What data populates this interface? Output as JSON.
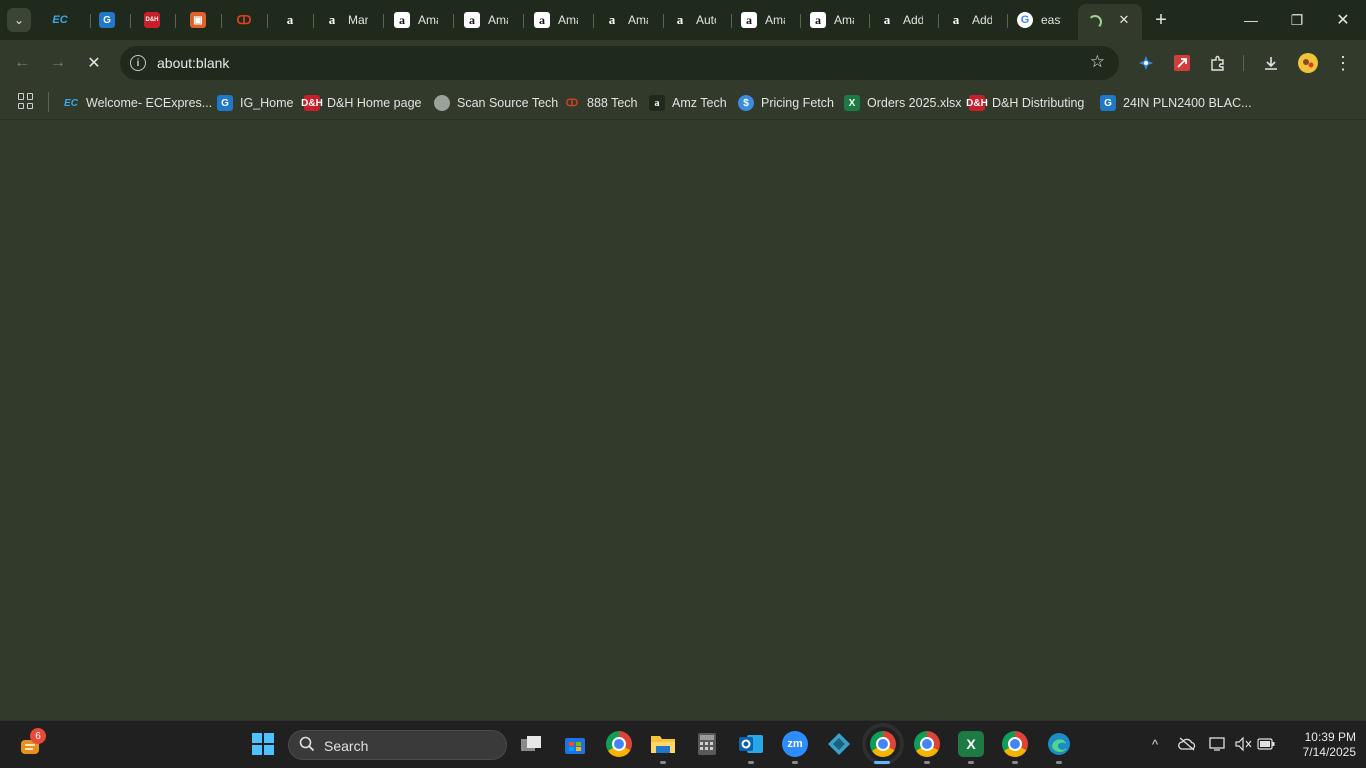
{
  "tabs": [
    {
      "title": "",
      "icon": "ec-icon"
    },
    {
      "title": "",
      "icon": "ig-icon"
    },
    {
      "title": "",
      "icon": "dh-icon"
    },
    {
      "title": "",
      "icon": "box-icon"
    },
    {
      "title": "",
      "icon": "ring-icon"
    },
    {
      "title": "",
      "icon": "amazon-icon"
    },
    {
      "title": "Man",
      "icon": "amazon-icon"
    },
    {
      "title": "Ama",
      "icon": "amazon-icon"
    },
    {
      "title": "Ama",
      "icon": "amazon-icon"
    },
    {
      "title": "Ama",
      "icon": "amazon-icon"
    },
    {
      "title": "Ama",
      "icon": "amazon-icon"
    },
    {
      "title": "Auto",
      "icon": "amazon-icon"
    },
    {
      "title": "Ama",
      "icon": "amazon-icon"
    },
    {
      "title": "Ama",
      "icon": "amazon-icon"
    },
    {
      "title": "Add",
      "icon": "amazon-icon"
    },
    {
      "title": "Add",
      "icon": "amazon-icon"
    },
    {
      "title": "east",
      "icon": "google-icon"
    },
    {
      "title": "",
      "icon": "loading-spinner",
      "active": true
    }
  ],
  "omnibox": {
    "url": "about:blank"
  },
  "bookmarks": [
    {
      "label": "Welcome- ECExpres...",
      "icon": "ec-icon"
    },
    {
      "label": "IG_Home",
      "icon": "ig-icon"
    },
    {
      "label": "D&H Home page",
      "icon": "dh-icon"
    },
    {
      "label": "Scan Source Tech",
      "icon": "globe-icon"
    },
    {
      "label": "888 Tech",
      "icon": "ring-icon"
    },
    {
      "label": "Amz Tech",
      "icon": "amazon-icon"
    },
    {
      "label": "Pricing Fetch",
      "icon": "dollar-icon"
    },
    {
      "label": "Orders 2025.xlsx",
      "icon": "excel-icon"
    },
    {
      "label": "D&H Distributing",
      "icon": "dh-icon"
    },
    {
      "label": "24IN PLN2400 BLAC...",
      "icon": "ig-icon"
    }
  ],
  "taskbar": {
    "search_placeholder": "Search",
    "widget_badge": "6",
    "time": "10:39 PM",
    "date": "7/14/2025"
  },
  "glyphs": {
    "fav_ec": "EC",
    "fav_ig": "G",
    "fav_dh": "D&H",
    "fav_box": "▣",
    "fav_ring": "ↀ",
    "fav_amz": "a",
    "fav_goog": "G",
    "fav_dollar": "$",
    "fav_excel": "X",
    "tab_close": "✕",
    "new_tab": "+",
    "minimize": "—",
    "restore": "❐",
    "close": "✕",
    "back": "←",
    "forward": "→",
    "stop": "✕",
    "info": "i",
    "star": "☆",
    "menu": "⋮",
    "chevron": "⌄",
    "tray_up": "^",
    "speaker": "🔈",
    "search": "⌕"
  },
  "colors": {
    "page_background": "#323a2c",
    "tabstrip": "#1f2a1c",
    "taskbar": "#202020",
    "loading_accent": "#9ed28a"
  }
}
